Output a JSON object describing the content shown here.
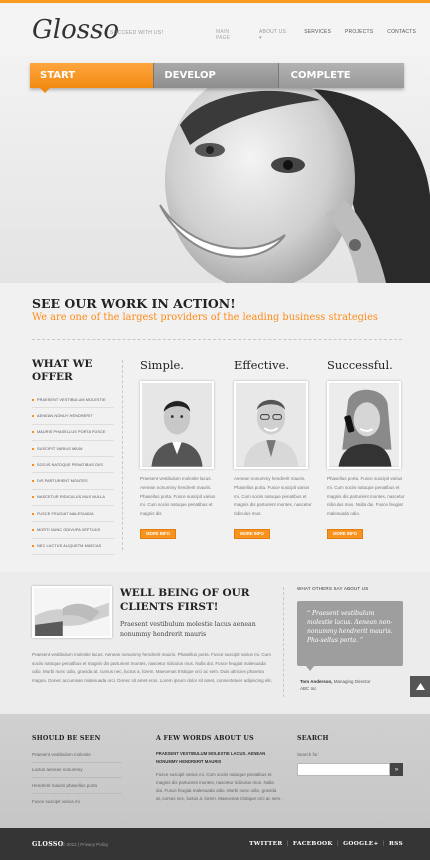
{
  "header": {
    "logo": "Glosso",
    "tagline": "SUCCEED WITH US!",
    "nav": [
      "MAIN PAGE",
      "ABOUT US ▾",
      "SERVICES",
      "PROJECTS",
      "CONTACTS"
    ]
  },
  "hero": {
    "tabs": [
      "START",
      "DEVELOP",
      "COMPLETE"
    ],
    "active_tab": "START"
  },
  "intro": {
    "title": "SEE OUR WORK IN ACTION!",
    "subtitle": "We are one of the largest providers of the leading business strategies"
  },
  "offer": {
    "title": "WHAT WE OFFER",
    "items": [
      "PRAESENT VESTIBULUM MOLESTIE",
      "AENEAN NONUY HENDRERIT",
      "MAURIS PHASELLUS PORTA FUSCE",
      "SUSCIPIT VARIUS MIUM",
      "SOCIIS NATOQUE PENATIBUS DIIS",
      "DIS PARTURIENT MONTES",
      "NASCETUR RIDICULUS MUS NULLA",
      "FUSCE FEUGIAT MALESUADA",
      "MORTI NUNC ODIVUPA VEFTUUS",
      "NEC LUCTUS ALIQUETM MAECAS"
    ]
  },
  "columns": [
    {
      "title": "Simple.",
      "text": "Praesent vestibulum molestie lacus. Aenean nonummy hendrerit mauris. Phasellus porta. Fusce suscipit varius mi. Cum sociis natoque penatibus et magnis dis",
      "button": "MORE INFO"
    },
    {
      "title": "Effective.",
      "text": "Aenean nonummy hendrerit mauris. Phasellus porta. Fusce suscipit varius mi. Cum sociis natoque penatibus et magnis dis parturient montes, nascetur ridiculus mus.",
      "button": "MORE INFO"
    },
    {
      "title": "Successful.",
      "text": "Phasellus porta. Fusce suscipit varius mi. Cum sociis natoque penatibus et magnis dis parturient montes, nascetur ridiculus mus. Nulla dui. Fusce feugiat malesuada odio.",
      "button": "MORE INFO"
    }
  ],
  "wellbeing": {
    "title": "WELL BEING OF OUR CLIENTS FIRST!",
    "subtitle": "Praesent vestibulum molestie lacus aenean nonummy hendrerit mauris",
    "body": "Praesent vestibulum molestie lacus. Aenean nonummy hendrerit mauris. Phasellus porta. Fusce suscipit varius mi. Cum sociis natoque penatibus et magnis dis parturient montes, nascetur ridiculus mus. Nulla dui. Fusce feugiat malesuada odio. Morbi nunc odio, gravida at, cursus nec, luctus a, lorem. Maecenas tristique orci ac sem. Duis ultricies pharetra magna. Donec accumsan malesuada orci. Donec sit amet eros. Lorem ipsum dolor sit amet, consectetuer adipiscing elit."
  },
  "testimonial": {
    "label": "WHAT OTHERS SAY ABOUT US",
    "quote": "“ Praesent vestibulum molestie lacus. Aenean non-nonummy hendrerit mauris. Pha-sellus porta. ”",
    "author_name": "Tom Anderson,",
    "author_role": "Managing Director",
    "author_company": "ABC Inc"
  },
  "footer": {
    "col1_title": "SHOULD BE SEEN",
    "col1_links": [
      "Praesent vestibulum molestie",
      "Luctus aenean nonummy",
      "Hendrerit mauris phasellus porta",
      "Fusce suscipit varius mi"
    ],
    "col2_title": "A FEW WORDS ABOUT US",
    "col2_bold": "PRAESENT VESTIBULUM MOLESTIE LACUS. AENEAN NONUMMY HENDRERIT MAURIS",
    "col2_body": "Fusce suscipit varius mi. Cum sociis natoque penatibus et magnis dis parturient montes, nascetur ridiculus mus. Nulla dui. Fusce feugiat malesuada odio. Morbi nunc odio, gravida at, cursus nec, luctus a, lorem. Maecenas tristique orci ac sem.",
    "col3_title": "SEARCH",
    "search_label": "Search for:",
    "search_placeholder": "",
    "search_button": "»"
  },
  "bottom": {
    "logo": "GLOSSO",
    "copyright": "© 2012 | Privacy Policy",
    "social": [
      "TWITTER",
      "FACEBOOK",
      "GOOGLE+",
      "RSS"
    ]
  },
  "colors": {
    "accent": "#ff9a1f",
    "dark": "#353535"
  },
  "icons": {
    "to_top": "arrow-up-icon",
    "search_submit": "arrow-right-icon"
  }
}
